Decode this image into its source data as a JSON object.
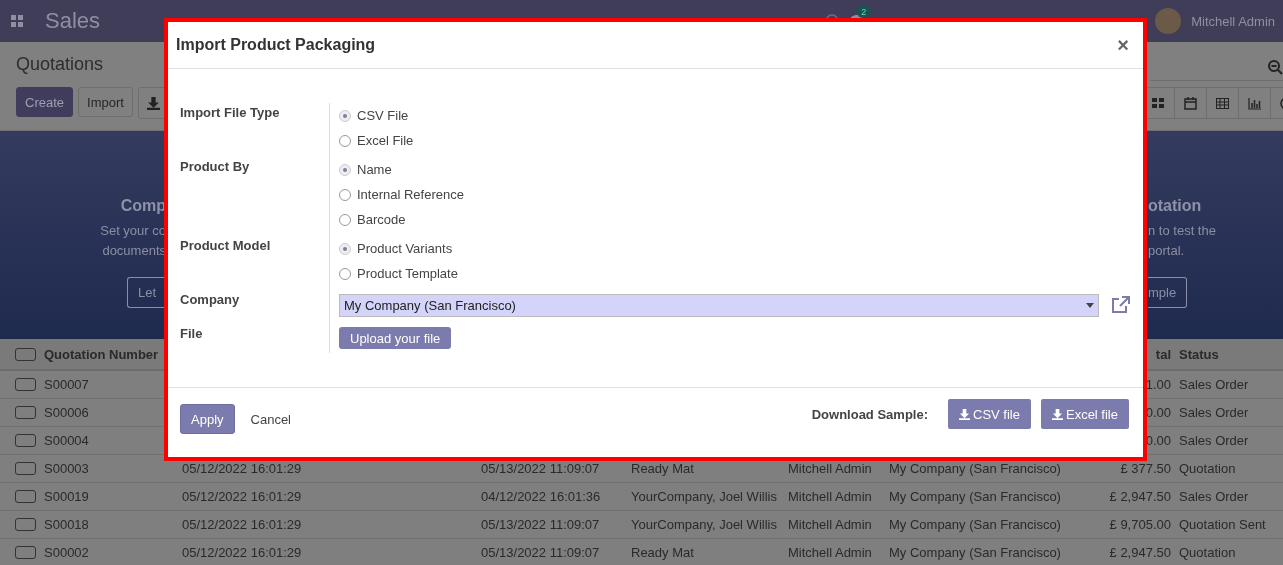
{
  "navbar": {
    "app_title": "Sales",
    "chat_badge": "2",
    "user": "Mitchell Admin"
  },
  "control_panel": {
    "title": "Quotations",
    "buttons": [
      {
        "label": "Create",
        "kind": "primary"
      },
      {
        "label": "Import",
        "kind": "secondary"
      }
    ]
  },
  "banner": {
    "left": {
      "title": "Comp",
      "lines": [
        "Set your co",
        "documents"
      ],
      "button": "Let"
    },
    "right": {
      "title": "otation",
      "lines": [
        "n to test the",
        "portal."
      ],
      "button": "mple"
    }
  },
  "table": {
    "header": {
      "checked": false,
      "number": "Quotation Number",
      "total": "tal",
      "status": "Status"
    },
    "rows": [
      {
        "checked": false,
        "number": "S00007",
        "total": "1.00",
        "status": "Sales Order"
      },
      {
        "checked": false,
        "number": "S00006",
        "total": "0.00",
        "status": "Sales Order"
      },
      {
        "checked": false,
        "number": "S00004",
        "total": "0.00",
        "status": "Sales Order"
      },
      {
        "checked": false,
        "number": "S00003",
        "created": "05/12/2022 16:01:29",
        "date": "05/13/2022 11:09:07",
        "customer": "Ready Mat",
        "salesperson": "Mitchell Admin",
        "company": "My Company (San Francisco)",
        "total": "£ 377.50",
        "status": "Quotation"
      },
      {
        "checked": false,
        "number": "S00019",
        "created": "05/12/2022 16:01:29",
        "date": "04/12/2022 16:01:36",
        "customer": "YourCompany, Joel Willis",
        "salesperson": "Mitchell Admin",
        "company": "My Company (San Francisco)",
        "total": "£ 2,947.50",
        "status": "Sales Order"
      },
      {
        "checked": false,
        "number": "S00018",
        "created": "05/12/2022 16:01:29",
        "date": "05/13/2022 11:09:07",
        "customer": "YourCompany, Joel Willis",
        "salesperson": "Mitchell Admin",
        "company": "My Company (San Francisco)",
        "total": "£ 9,705.00",
        "status": "Quotation Sent"
      },
      {
        "checked": false,
        "number": "S00002",
        "created": "05/12/2022 16:01:29",
        "date": "05/13/2022 11:09:07",
        "customer": "Ready Mat",
        "salesperson": "Mitchell Admin",
        "company": "My Company (San Francisco)",
        "total": "£ 2,947.50",
        "status": "Quotation"
      }
    ]
  },
  "dialog": {
    "title": "Import Product Packaging",
    "close": "×",
    "fields": [
      {
        "label": "Import File Type",
        "kind": "radio",
        "options": [
          {
            "label": "CSV File",
            "selected": true
          },
          {
            "label": "Excel File",
            "selected": false
          }
        ]
      },
      {
        "label": "Product By",
        "kind": "radio",
        "options": [
          {
            "label": "Name",
            "selected": true
          },
          {
            "label": "Internal Reference",
            "selected": false
          },
          {
            "label": "Barcode",
            "selected": false
          }
        ]
      },
      {
        "label": "Product Model",
        "kind": "radio",
        "options": [
          {
            "label": "Product Variants",
            "selected": true
          },
          {
            "label": "Product Template",
            "selected": false
          }
        ]
      },
      {
        "label": "Company",
        "kind": "select",
        "value": "My Company (San Francisco)"
      },
      {
        "label": "File",
        "kind": "upload",
        "button": "Upload your file"
      }
    ],
    "apply": "Apply",
    "cancel": "Cancel",
    "download_label": "Download Sample:",
    "downloads": [
      "CSV file",
      "Excel file"
    ]
  }
}
